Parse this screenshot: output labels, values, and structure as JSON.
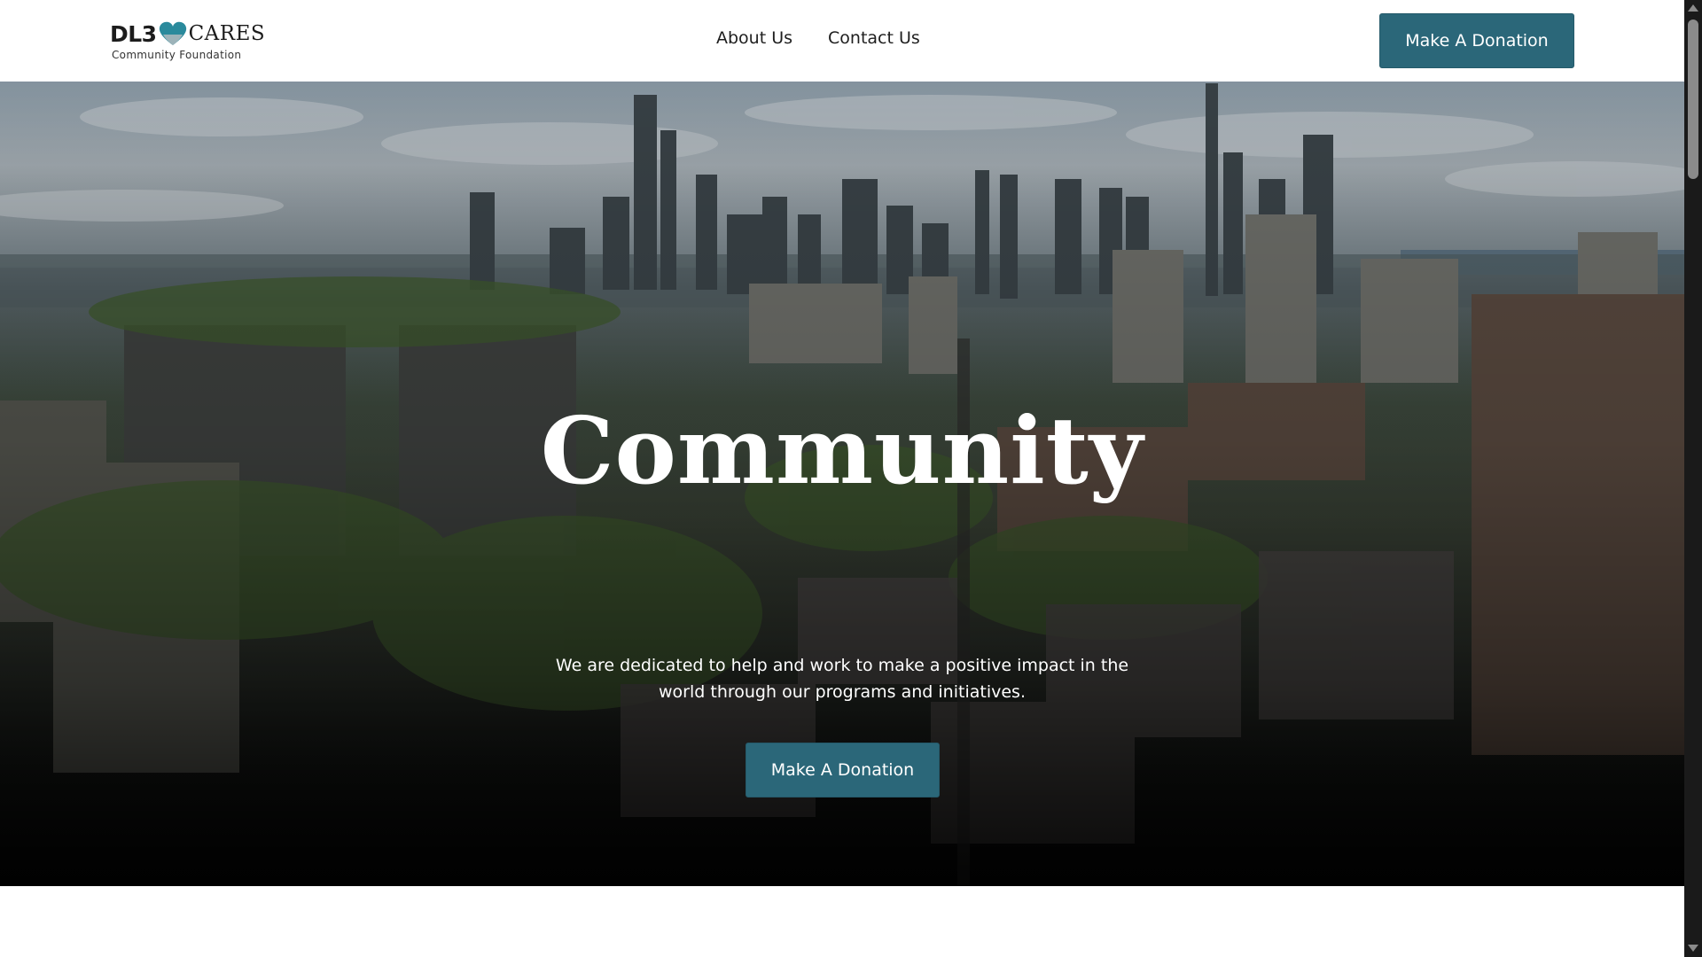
{
  "header": {
    "logo": {
      "brand_left": "DL3",
      "brand_right": "CARES",
      "tagline": "Community Foundation",
      "heart_color": "#2a8a9c"
    },
    "nav": [
      {
        "label": "About Us"
      },
      {
        "label": "Contact Us"
      }
    ],
    "donate_label": "Make A Donation"
  },
  "hero": {
    "title": "Community",
    "text": "We are dedicated to help and work to make a positive impact in the world through our programs and initiatives.",
    "donate_label": "Make A Donation",
    "background": "aerial-city-skyline-image"
  },
  "colors": {
    "accent": "#2b6779",
    "hero_text": "#ffffff"
  }
}
